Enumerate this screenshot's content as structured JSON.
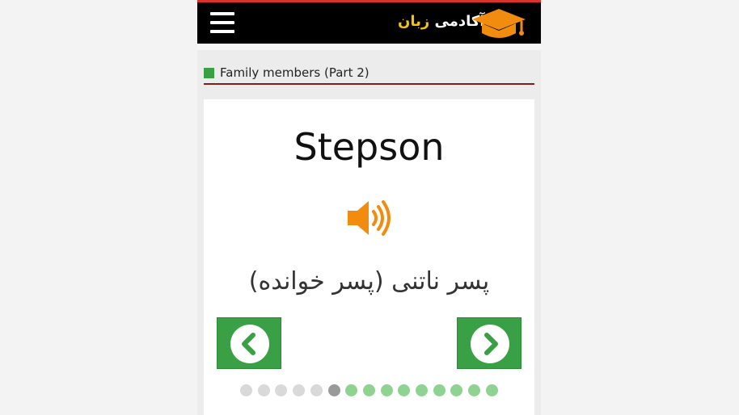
{
  "header": {
    "logo_word1": "آکادمی",
    "logo_word2": "زبان",
    "menu_icon": "hamburger-menu-icon",
    "logo_icon": "graduation-cap-icon"
  },
  "lesson": {
    "title": "Family members (Part 2)"
  },
  "card": {
    "word": "Stepson",
    "translation": "پسر ناتنی (پسر خوانده)",
    "audio_icon": "speaker-icon",
    "prev_icon": "chevron-left-icon",
    "next_icon": "chevron-right-icon"
  },
  "pager": {
    "total": 15,
    "current": 6,
    "dots": [
      "gray",
      "gray",
      "gray",
      "gray",
      "gray",
      "active",
      "green",
      "green",
      "green",
      "green",
      "green",
      "green",
      "green",
      "green",
      "green"
    ]
  },
  "colors": {
    "accent_green": "#3aa046",
    "speaker_orange": "#f28c0f",
    "logo_gold": "#f7c20b",
    "header_bg": "#000000",
    "title_rule": "#7b1f1f"
  }
}
